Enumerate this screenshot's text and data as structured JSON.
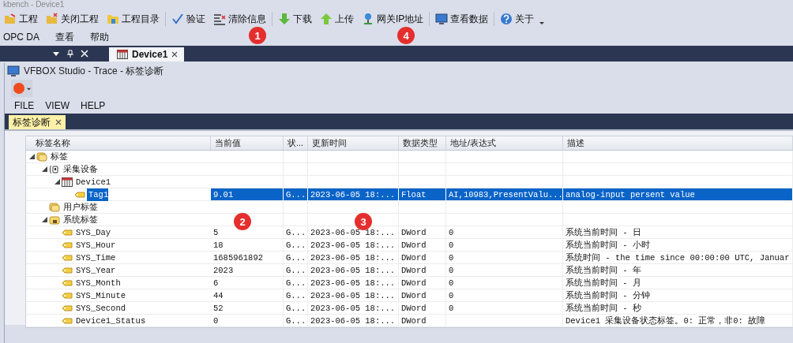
{
  "app_window": {
    "title": "kbench - Device1"
  },
  "toolbar": [
    {
      "label": "工程",
      "kind": "open",
      "sep": false
    },
    {
      "label": "关闭工程",
      "kind": "close",
      "sep": false
    },
    {
      "label": "工程目录",
      "kind": "folder",
      "sep": false
    },
    {
      "label": "验证",
      "kind": "check",
      "sep": true
    },
    {
      "label": "清除信息",
      "kind": "clear",
      "sep": false
    },
    {
      "label": "下载",
      "kind": "down",
      "sep": true
    },
    {
      "label": "上传",
      "kind": "up",
      "sep": false
    },
    {
      "label": "网关IP地址",
      "kind": "net",
      "sep": false
    },
    {
      "label": "查看数据",
      "kind": "monitor",
      "sep": true
    },
    {
      "label": "关于",
      "kind": "help",
      "sep": true
    }
  ],
  "menu": [
    "OPC DA",
    "查看",
    "帮助"
  ],
  "document_tabs": [
    {
      "label": "Device1",
      "selected": true
    }
  ],
  "trace_window": {
    "title": "VFBOX Studio - Trace - 标签诊断",
    "menu": [
      "FILE",
      "VIEW",
      "HELP"
    ],
    "tabs": [
      {
        "label": "标签诊断",
        "selected": true
      }
    ]
  },
  "table": {
    "columns": [
      "标签名称",
      "当前值",
      "状...",
      "更新时间",
      "数据类型",
      "地址/表达式",
      "描述"
    ],
    "rows": [
      {
        "name": "标签",
        "kind": "group",
        "expanded": true,
        "selected": false,
        "children": [
          {
            "name": "采集设备",
            "kind": "collector",
            "expanded": true,
            "selected": false,
            "children": [
              {
                "name": "Device1",
                "kind": "device",
                "expanded": true,
                "selected": false,
                "children": [
                  {
                    "name": "Tag1",
                    "kind": "tag",
                    "selected": true,
                    "value": "9.01",
                    "status": "G...",
                    "time": "2023-06-05 18:...",
                    "type": "Float",
                    "address": "AI,10983,PresentValu...",
                    "description": "analog-input persent value"
                  }
                ]
              }
            ]
          },
          {
            "name": "用户标签",
            "kind": "group",
            "selected": false
          },
          {
            "name": "系统标签",
            "kind": "sysgroup",
            "expanded": true,
            "selected": false,
            "children": [
              {
                "name": "SYS_Day",
                "kind": "tag",
                "selected": false,
                "value": "5",
                "status": "G...",
                "time": "2023-06-05 18:...",
                "type": "DWord",
                "address": "0",
                "description": "系统当前时间 - 日"
              },
              {
                "name": "SYS_Hour",
                "kind": "tag",
                "selected": false,
                "value": "18",
                "status": "G...",
                "time": "2023-06-05 18:...",
                "type": "DWord",
                "address": "0",
                "description": "系统当前时间 - 小时"
              },
              {
                "name": "SYS_Time",
                "kind": "tag",
                "selected": false,
                "value": "1685961892",
                "status": "G...",
                "time": "2023-06-05 18:...",
                "type": "DWord",
                "address": "0",
                "description": "系统时间 - the time since 00:00:00 UTC, Januar"
              },
              {
                "name": "SYS_Year",
                "kind": "tag",
                "selected": false,
                "value": "2023",
                "status": "G...",
                "time": "2023-06-05 18:...",
                "type": "DWord",
                "address": "0",
                "description": "系统当前时间 - 年"
              },
              {
                "name": "SYS_Month",
                "kind": "tag",
                "selected": false,
                "value": "6",
                "status": "G...",
                "time": "2023-06-05 18:...",
                "type": "DWord",
                "address": "0",
                "description": "系统当前时间 - 月"
              },
              {
                "name": "SYS_Minute",
                "kind": "tag",
                "selected": false,
                "value": "44",
                "status": "G...",
                "time": "2023-06-05 18:...",
                "type": "DWord",
                "address": "0",
                "description": "系统当前时间 - 分钟"
              },
              {
                "name": "SYS_Second",
                "kind": "tag",
                "selected": false,
                "value": "52",
                "status": "G...",
                "time": "2023-06-05 18:...",
                "type": "DWord",
                "address": "0",
                "description": "系统当前时间 - 秒"
              },
              {
                "name": "Device1_Status",
                "kind": "tag",
                "selected": false,
                "value": "0",
                "status": "G...",
                "time": "2023-06-05 18:...",
                "type": "DWord",
                "description": "Device1 采集设备状态标签。0: 正常，非0: 故障"
              }
            ]
          }
        ]
      }
    ]
  },
  "annotations": [
    "1",
    "4",
    "2",
    "3"
  ]
}
